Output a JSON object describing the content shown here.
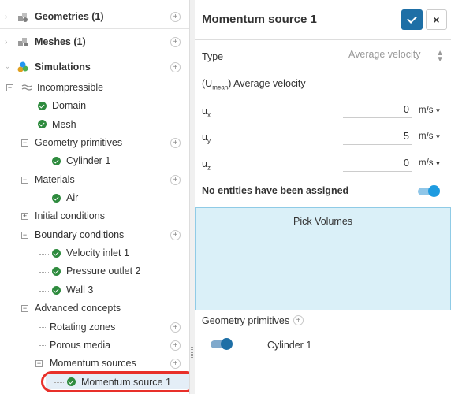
{
  "tree": {
    "sections": [
      {
        "title": "Geometries (1)",
        "icon": "geometries-icon"
      },
      {
        "title": "Meshes (1)",
        "icon": "meshes-icon"
      },
      {
        "title": "Simulations",
        "icon": "simulations-icon"
      }
    ],
    "simulation_name": "Incompressible",
    "nodes": {
      "domain": "Domain",
      "mesh": "Mesh",
      "geometry_primitives": "Geometry primitives",
      "cylinder": "Cylinder 1",
      "materials": "Materials",
      "air": "Air",
      "initial_conditions": "Initial conditions",
      "boundary_conditions": "Boundary conditions",
      "velocity_inlet": "Velocity inlet 1",
      "pressure_outlet": "Pressure outlet 2",
      "wall": "Wall 3",
      "advanced_concepts": "Advanced concepts",
      "rotating_zones": "Rotating zones",
      "porous_media": "Porous media",
      "momentum_sources": "Momentum sources",
      "momentum_source_1": "Momentum source 1"
    },
    "expander_minus": "−",
    "expander_plus": "+",
    "plus_symbol": "+"
  },
  "panel": {
    "title": "Momentum source 1",
    "close_symbol": "×",
    "type_label": "Type",
    "type_value": "Average velocity",
    "type_arrows": "▲\n▼",
    "avg_prefix": "(U",
    "avg_sub": "mean",
    "avg_suffix": ") Average velocity",
    "ux_label": "u",
    "ux_sub": "x",
    "ux_value": "0",
    "uy_label": "u",
    "uy_sub": "y",
    "uy_value": "5",
    "uz_label": "u",
    "uz_sub": "z",
    "uz_value": "0",
    "unit": "m/s",
    "unit_caret": "▼",
    "no_entities": "No entities have been assigned",
    "pick_volumes": "Pick Volumes",
    "geometry_primitives": "Geometry primitives",
    "cylinder": "Cylinder 1"
  },
  "colors": {
    "accent": "#1e6fa6",
    "check_green": "#2e8b3e",
    "pick_bg": "#daf0f8",
    "highlight_ring": "#e8302a"
  }
}
